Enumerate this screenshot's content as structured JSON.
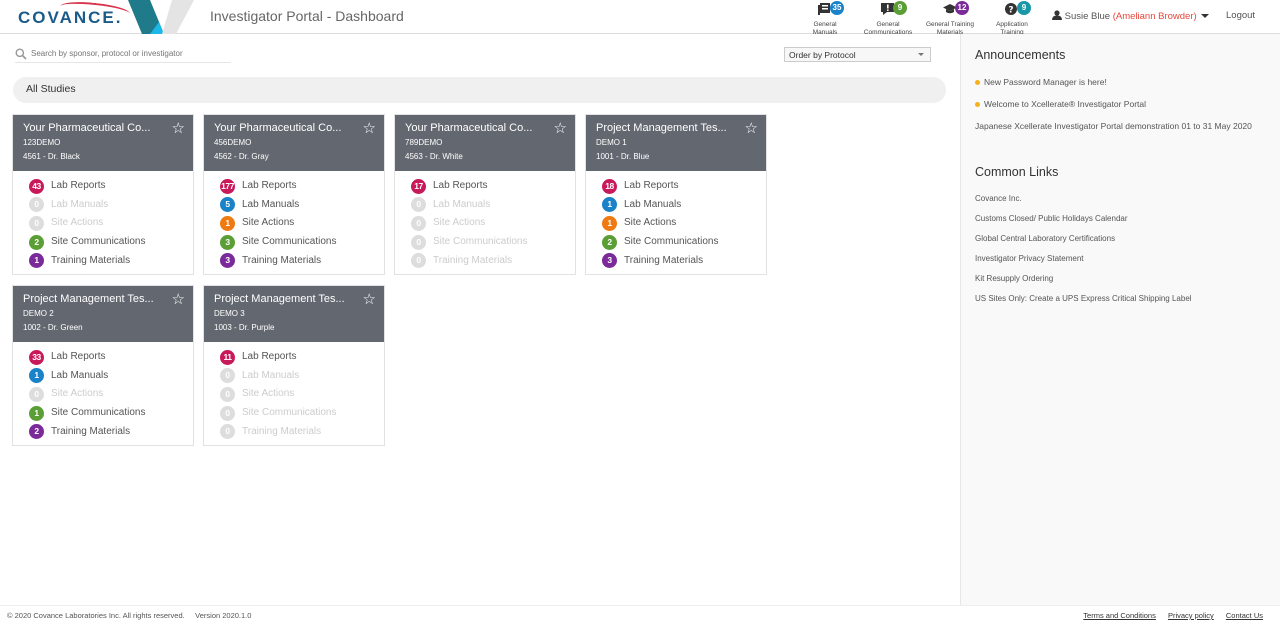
{
  "header": {
    "logo_text": "COVANCE.",
    "app_title": "Investigator Portal - Dashboard",
    "icons": [
      {
        "name": "general-manuals",
        "label1": "General",
        "label2": "Manuals",
        "count": "35",
        "color": "#1a82c9",
        "glyph": "book"
      },
      {
        "name": "general-communications",
        "label1": "General",
        "label2": "Communications",
        "count": "9",
        "color": "#5a9e35",
        "glyph": "comment-exclamation"
      },
      {
        "name": "general-training-materials",
        "label1": "General Training",
        "label2": "Materials",
        "count": "12",
        "color": "#7b2a9a",
        "glyph": "graduation-cap"
      },
      {
        "name": "application-training",
        "label1": "Application",
        "label2": "Training",
        "count": "9",
        "color": "#1897a8",
        "glyph": "question-circle"
      }
    ],
    "user_name": "Susie Blue",
    "user_alias": "(Ameliann Browder)",
    "logout_label": "Logout"
  },
  "toolbar": {
    "search_placeholder": "Search by sponsor, protocol or investigator",
    "search_value": "",
    "order_selected": "Order by Protocol",
    "section_label": "All Studies"
  },
  "category_labels": [
    "Lab Reports",
    "Lab Manuals",
    "Site Actions",
    "Site Communications",
    "Training Materials"
  ],
  "category_colors": [
    "#c8195a",
    "#1a82c9",
    "#ef7a12",
    "#5a9e35",
    "#7b2a9a"
  ],
  "studies": [
    {
      "title": "Your Pharmaceutical Co...",
      "protocol": "123DEMO",
      "site": "4561 - Dr. Black",
      "counts": [
        "43",
        "0",
        "0",
        "2",
        "1"
      ]
    },
    {
      "title": "Your Pharmaceutical Co...",
      "protocol": "456DEMO",
      "site": "4562 - Dr. Gray",
      "counts": [
        "177",
        "5",
        "1",
        "3",
        "3"
      ]
    },
    {
      "title": "Your Pharmaceutical Co...",
      "protocol": "789DEMO",
      "site": "4563 - Dr. White",
      "counts": [
        "17",
        "0",
        "0",
        "0",
        "0"
      ]
    },
    {
      "title": "Project Management Tes...",
      "protocol": "DEMO 1",
      "site": "1001 - Dr. Blue",
      "counts": [
        "18",
        "1",
        "1",
        "2",
        "3"
      ]
    },
    {
      "title": "Project Management Tes...",
      "protocol": "DEMO 2",
      "site": "1002 - Dr. Green",
      "counts": [
        "33",
        "1",
        "0",
        "1",
        "2"
      ]
    },
    {
      "title": "Project Management Tes...",
      "protocol": "DEMO 3",
      "site": "1003 - Dr. Purple",
      "counts": [
        "11",
        "0",
        "0",
        "0",
        "0"
      ]
    }
  ],
  "sidebar": {
    "announcements_title": "Announcements",
    "announcements": [
      {
        "text": "New Password Manager is here!",
        "bullet": true
      },
      {
        "text": "Welcome to Xcellerate® Investigator Portal",
        "bullet": true
      },
      {
        "text": "Japanese Xcellerate Investigator Portal demonstration 01 to 31 May 2020",
        "bullet": false
      }
    ],
    "links_title": "Common Links",
    "links": [
      "Covance Inc.",
      "Customs Closed/ Public Holidays Calendar",
      "Global Central Laboratory Certifications",
      "Investigator Privacy Statement",
      "Kit Resupply Ordering",
      "US Sites Only: Create a UPS Express Critical Shipping Label"
    ]
  },
  "footer": {
    "copyright": "© 2020 Covance Laboratories Inc. All rights reserved.",
    "version": "Version 2020.1.0",
    "links": [
      "Terms and Conditions",
      "Privacy policy",
      "Contact Us"
    ]
  }
}
